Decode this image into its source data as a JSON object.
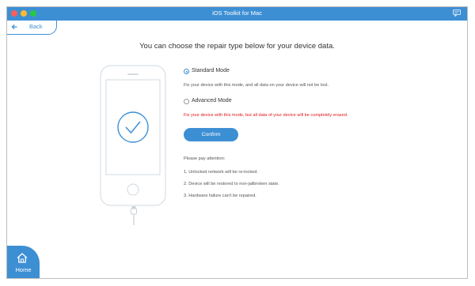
{
  "window": {
    "title": "iOS Toolkit for Mac"
  },
  "header": {
    "back_label": "Back"
  },
  "main": {
    "heading": "You can choose the repair type below for your device data.",
    "options": [
      {
        "label": "Standard Mode",
        "description": "Fix your device with this mode, and all data on your device will not be lost.",
        "selected": true
      },
      {
        "label": "Advanced Mode",
        "description": "Fix your device with this mode, but all data of your device will be completely erased.",
        "selected": false
      }
    ],
    "confirm_label": "Confirm",
    "attention": {
      "title": "Please pay attention:",
      "items": [
        "1.  Unlocked network will be re-locked.",
        "2.  Device will be restored to non-jailbroken state.",
        "3.  Hardware failure can't be repaired."
      ]
    }
  },
  "footer": {
    "home_label": "Home"
  },
  "colors": {
    "accent": "#3d8fd4",
    "warning": "#e0191a"
  },
  "icons": [
    "feedback-icon",
    "back-arrow-icon",
    "checkmark-icon",
    "home-icon"
  ]
}
